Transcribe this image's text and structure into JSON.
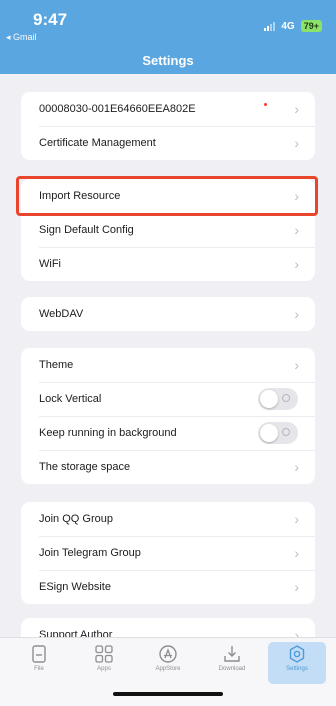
{
  "status_bar": {
    "time": "9:47",
    "back_app": "◂ Gmail",
    "network": "4G",
    "battery": "79+"
  },
  "header": {
    "title": "Settings"
  },
  "groups": [
    {
      "rows": [
        {
          "label": "00008030-001E64660EEA802E"
        },
        {
          "label": "Certificate Management"
        }
      ]
    },
    {
      "rows": [
        {
          "label": "Import Resource"
        },
        {
          "label": "Sign Default Config"
        },
        {
          "label": "WiFi"
        }
      ]
    },
    {
      "rows": [
        {
          "label": "WebDAV"
        }
      ]
    },
    {
      "rows": [
        {
          "label": "Theme"
        },
        {
          "label": "Lock Vertical",
          "toggle": false
        },
        {
          "label": "Keep running in background",
          "toggle": false
        },
        {
          "label": "The storage space"
        }
      ]
    },
    {
      "rows": [
        {
          "label": "Join QQ Group"
        },
        {
          "label": "Join Telegram Group"
        },
        {
          "label": "ESign Website"
        }
      ]
    },
    {
      "rows": [
        {
          "label": "Support Author"
        }
      ]
    }
  ],
  "tabs": [
    {
      "label": "File",
      "icon": "file-icon"
    },
    {
      "label": "Apps",
      "icon": "apps-grid-icon"
    },
    {
      "label": "AppStore",
      "icon": "appstore-icon"
    },
    {
      "label": "Download",
      "icon": "download-icon"
    },
    {
      "label": "Settings",
      "icon": "gear-icon",
      "active": true
    }
  ],
  "colors": {
    "header": "#5aa6e0",
    "highlight": "#e8452c",
    "active_tab": "#4e9ad7",
    "battery": "#8be36a"
  }
}
